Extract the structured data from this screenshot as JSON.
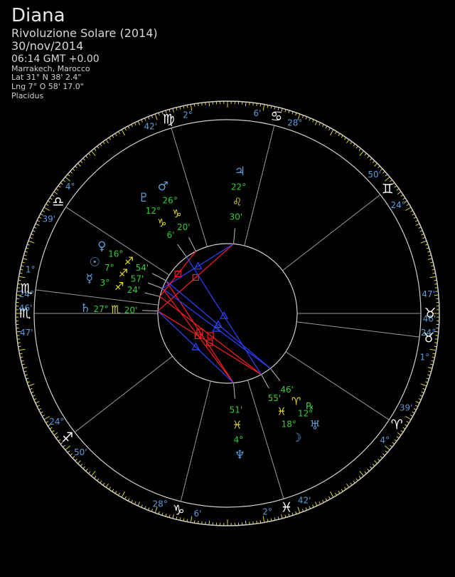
{
  "header": {
    "name": "Diana",
    "chart_type": "Rivoluzione Solare (2014)",
    "date": "30/nov/2014",
    "time": "06:14 GMT +0.00",
    "place": "Marrakech, Marocco",
    "lat": "Lat 31° N 38' 2.4\"",
    "lng": "Lng 7° O 58' 17.0\"",
    "house_system": "Placidus"
  },
  "colors": {
    "cusp_label": "#5a9bd8",
    "planet_deg": "#33cc33",
    "planet_min": "#33cc33",
    "aspect_square": "#ff2020",
    "aspect_trine": "#3040ff",
    "ring": "#cfcfcf",
    "tick": "#e0d030"
  },
  "houses": [
    {
      "deg": "24°",
      "sign": "♏",
      "min": "47'"
    },
    {
      "deg": "24°",
      "sign": "♐",
      "min": "50'"
    },
    {
      "deg": "28°",
      "sign": "♑",
      "min": "6'"
    },
    {
      "deg": "2°",
      "sign": "♓",
      "min": "42'"
    },
    {
      "deg": "4°",
      "sign": "♈",
      "min": "39'"
    },
    {
      "deg": "1°",
      "sign": "♉",
      "min": "46'"
    },
    {
      "deg": "24°",
      "sign": "♉",
      "min": "47'"
    },
    {
      "deg": "24°",
      "sign": "♊",
      "min": "50'"
    },
    {
      "deg": "28°",
      "sign": "♋",
      "min": "6'"
    },
    {
      "deg": "2°",
      "sign": "♍",
      "min": "42'"
    },
    {
      "deg": "4°",
      "sign": "♎",
      "min": "39'"
    },
    {
      "deg": "1°",
      "sign": "♏",
      "min": "46'"
    }
  ],
  "planets": [
    {
      "glyph": "♃",
      "deg": "22°",
      "sign": "♌",
      "min": "30'"
    },
    {
      "glyph": "♄",
      "deg": "27°",
      "sign": "♏",
      "min": "20'"
    },
    {
      "glyph": "☿",
      "deg": "3°",
      "sign": "♐",
      "min": "24'"
    },
    {
      "glyph": "☉",
      "deg": "7°",
      "sign": "♐",
      "min": "57'"
    },
    {
      "glyph": "♀",
      "deg": "16°",
      "sign": "♐",
      "min": "54'"
    },
    {
      "glyph": "♇",
      "deg": "12°",
      "sign": "♑",
      "min": "6'"
    },
    {
      "glyph": "♂",
      "deg": "26°",
      "sign": "♑",
      "min": "20'"
    },
    {
      "glyph": "♆",
      "deg": "4°",
      "sign": "♓",
      "min": "51'"
    },
    {
      "glyph": "☽",
      "deg": "18°",
      "sign": "♓",
      "min": "55'"
    },
    {
      "glyph": "♅",
      "deg": "12°",
      "sign": "♈",
      "min": "46'",
      "retro": "℞"
    }
  ]
}
